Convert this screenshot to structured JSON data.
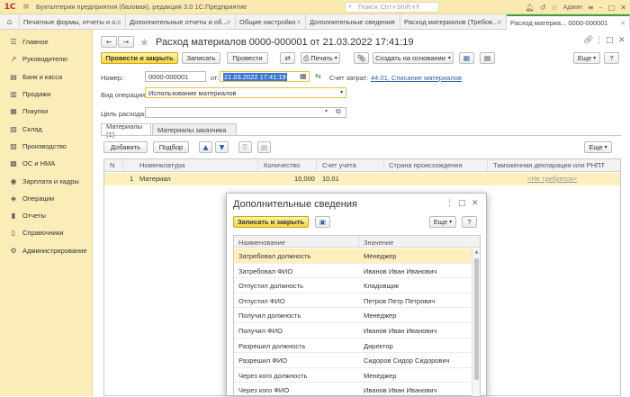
{
  "app": {
    "logo": "1С",
    "title": "Бухгалтерия предприятия (базовая), редакция 3.0 1С:Предприятие",
    "search_placeholder": "Поиск Ctrl+Shift+F",
    "user": "Админ"
  },
  "tabs": [
    {
      "label": "Печатные формы, отчеты и о..."
    },
    {
      "label": "Дополнительные отчеты и об..."
    },
    {
      "label": "Общие настройки"
    },
    {
      "label": "Дополнительные сведения"
    },
    {
      "label": "Расход материалов (Требов..."
    },
    {
      "label": "Расход материа... 0000-000001"
    }
  ],
  "sidebar": {
    "items": [
      {
        "label": "Главное",
        "icon": "☰"
      },
      {
        "label": "Руководителю",
        "icon": "↗"
      },
      {
        "label": "Банк и касса",
        "icon": "▤"
      },
      {
        "label": "Продажи",
        "icon": "▥"
      },
      {
        "label": "Покупки",
        "icon": "▦"
      },
      {
        "label": "Склад",
        "icon": "▧"
      },
      {
        "label": "Производство",
        "icon": "▨"
      },
      {
        "label": "ОС и НМА",
        "icon": "▩"
      },
      {
        "label": "Зарплата и кадры",
        "icon": "◉"
      },
      {
        "label": "Операции",
        "icon": "◈"
      },
      {
        "label": "Отчеты",
        "icon": "▮"
      },
      {
        "label": "Справочники",
        "icon": "▯"
      },
      {
        "label": "Администрирование",
        "icon": "⚙"
      }
    ]
  },
  "document": {
    "title": "Расход материалов 0000-000001 от 21.03.2022 17:41:19",
    "toolbar": {
      "post_close": "Провести и закрыть",
      "save": "Записать",
      "post": "Провести",
      "print": "Печать",
      "create_based": "Создать на основании",
      "more": "Еще"
    },
    "number_label": "Номер:",
    "number_value": "0000-000001",
    "date_label": "от:",
    "date_value": "21.03.2022 17:41:19",
    "cost_account_label": "Счет затрат:",
    "cost_account_value": "44.01, Списание материалов",
    "operation_label": "Вид операции:",
    "operation_value": "Использование материалов",
    "purpose_label": "Цель расхода:",
    "purpose_value": "",
    "form_tabs": [
      "Материалы (1)",
      "Материалы заказчика"
    ],
    "grid_toolbar": {
      "add": "Добавить",
      "pick": "Подбор",
      "more": "Еще"
    },
    "columns": [
      "N",
      "Номенклатура",
      "Количество",
      "Счет учета",
      "Страна происхождения",
      "Таможенная декларация или РНПТ"
    ],
    "rows": [
      {
        "n": "1",
        "item": "Материал",
        "qty": "10,000",
        "account": "10.01",
        "country": "",
        "customs": "<Не требуется>"
      }
    ]
  },
  "dialog": {
    "title": "Дополнительные сведения",
    "save_close": "Записать и закрыть",
    "more": "Еще",
    "help": "?",
    "columns": [
      "Наименование",
      "Значение"
    ],
    "rows": [
      {
        "name": "Затребовал должность",
        "value": "Менеджер"
      },
      {
        "name": "Затребовал ФИО",
        "value": "Иванов Иван Иванович"
      },
      {
        "name": "Отпустил должность",
        "value": "Кладовщик"
      },
      {
        "name": "Отпустил ФИО",
        "value": "Петров Петр Петрович"
      },
      {
        "name": "Получил должность",
        "value": "Менеджер"
      },
      {
        "name": "Получил ФИО",
        "value": "Иванов Иван Иванович"
      },
      {
        "name": "Разрешил должность",
        "value": "Директор"
      },
      {
        "name": "Разрешил ФИО",
        "value": "Сидоров Сидор Сидорович"
      },
      {
        "name": "Через кого должность",
        "value": "Менеджер"
      },
      {
        "name": "Через кого ФИО",
        "value": "Иванов Иван Иванович"
      }
    ]
  },
  "colors": {
    "accent_yellow": "#f6d73d",
    "sidebar": "#fbedb8",
    "selected_row": "#fdf0bd",
    "link": "#2b5ea8"
  }
}
